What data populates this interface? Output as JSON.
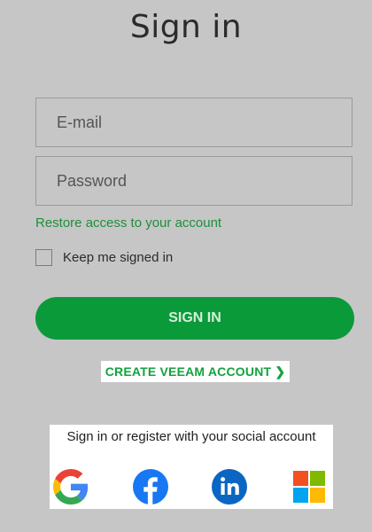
{
  "header": {
    "title": "Sign in"
  },
  "form": {
    "email_placeholder": "E-mail",
    "password_placeholder": "Password",
    "restore_link": "Restore access to your account",
    "keep_signed_in": "Keep me signed in",
    "signin_button": "SIGN IN",
    "create_account": "CREATE VEEAM ACCOUNT ❯"
  },
  "social": {
    "heading": "Sign in or register with your social account",
    "providers": [
      "google-icon",
      "facebook-icon",
      "linkedin-icon",
      "microsoft-icon"
    ]
  },
  "colors": {
    "background": "#c6c6c6",
    "accent": "#0b9a3a",
    "link": "#1e8f3a"
  }
}
